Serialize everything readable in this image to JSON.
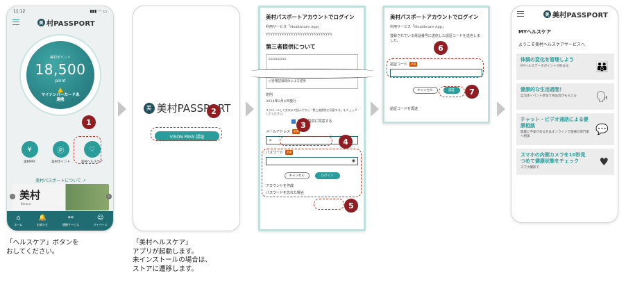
{
  "steps": [
    {
      "number": "1",
      "caption": "「ヘルスケア」ボタンを\nおしてください。"
    },
    {
      "number": "2",
      "caption": "「美村ヘルスケア」\nアプリが起動します。\n未インストールの場合は、\nストアに遷移します。"
    },
    {
      "number": "3"
    },
    {
      "number": "4"
    },
    {
      "number": "5"
    },
    {
      "number": "6"
    },
    {
      "number": "7"
    }
  ],
  "phone1": {
    "time": "11:12",
    "status_icons": "▮▮▮ ◠ ▭",
    "brand": "村PASSPORT",
    "logo_mark": "美",
    "point_label": "美村ポイント",
    "points": "18,500",
    "point_unit": "point",
    "mynumber_warning": "マイナンバーカード未\n連携",
    "buttons": [
      {
        "label": "美村PAY",
        "icon": "¥"
      },
      {
        "label": "美村ポイント",
        "icon": "Ⓟ"
      },
      {
        "label": "美村ヘルスケア",
        "icon": "♡"
      }
    ],
    "about_link": "美村パスポートについて",
    "banner_title": "美村",
    "banner_sub": "Bimura",
    "tabs": [
      {
        "label": "ホーム",
        "icon": "⌂"
      },
      {
        "label": "お知らせ",
        "icon": "🔔"
      },
      {
        "label": "連携サービス",
        "icon": "⚯"
      },
      {
        "label": "マイページ",
        "icon": "☺"
      }
    ]
  },
  "phone2": {
    "brand": "美村PASSPORT",
    "logo_mark": "美",
    "vison_button": "VISON PASS 認証"
  },
  "phone3": {
    "title": "美村パスポートアカウントでログイン",
    "service": "利用サービス「Healthcare App」",
    "service_id": "YYYYYYYYYYYYYYYYYYYYYYYYYYYYY",
    "section": "第三者提供について",
    "textbox_head": "xxxxxxxxxx",
    "textbox_body": "・CD-ROM、DVD-ROM、SDカード、ハードディスク、及び各種記録媒体による提供",
    "date_label": "附則",
    "date": "2024年2月4日施行",
    "scroll_note": "スクロールして文末まで読んでから「第三者提供に同意する」をチェックしてください。",
    "consent": "第三者提供に同意する",
    "email_label": "メールアドレス",
    "required": "必須",
    "email_value": "a",
    "password_label": "パスワード",
    "cancel": "キャンセル",
    "login": "ログイン",
    "create_account": "アカウントを作成",
    "forgot": "パスワードを忘れた場合"
  },
  "phone4": {
    "title": "美村パスポートアカウントでログイン",
    "service": "利用サービス「Healthcare App」",
    "instruction": "登録されている電話番号に送信した認証コードを送信しました。",
    "code_label": "認証コード",
    "required": "必須",
    "cancel": "キャンセル",
    "submit": "認証",
    "resend": "認証コードを再送"
  },
  "phone5": {
    "brand": "美村PASSPORT",
    "logo_mark": "美",
    "section": "MYヘルスケア",
    "welcome": "ようこそ美村ヘルスケアサービスへ",
    "cards": [
      {
        "title": "体調の変化を管理しよう",
        "sub": "MYヘルスデータポイントが貯まる",
        "icon": "👪"
      },
      {
        "title": "健康的な生活週間！",
        "sub": "自治体イベント参加で商品等がもらえる",
        "icon": "🗣"
      },
      {
        "title": "チャット・ビデオ通話による健康相談",
        "sub": "健康に不安がある方はオンラインで医療の専門家へ相談",
        "icon": "💬"
      },
      {
        "title": "スマホの内側カメラを10秒見つめて健康状態をチェック",
        "sub": "スマホ撮影で",
        "icon": "♥"
      }
    ]
  }
}
